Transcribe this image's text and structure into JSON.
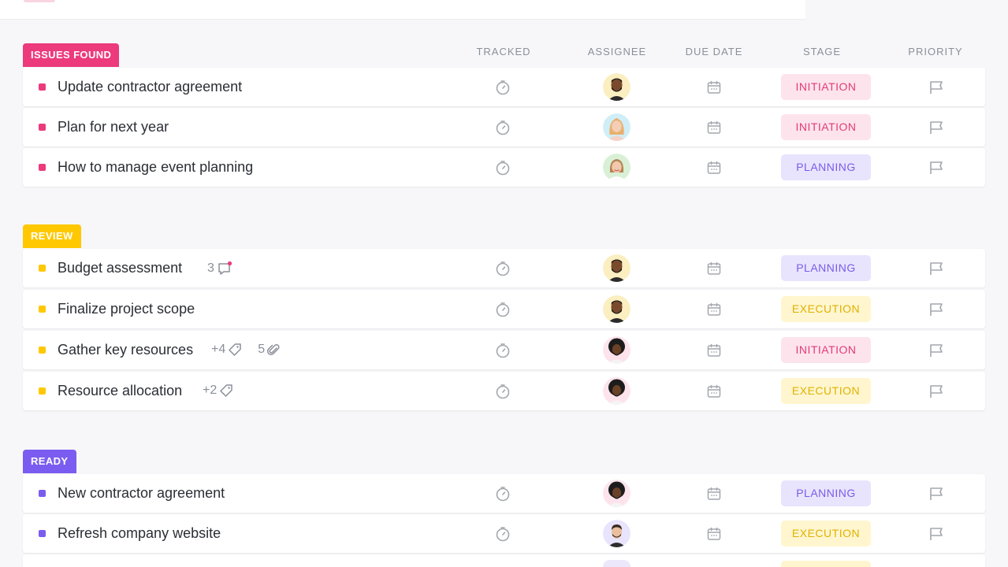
{
  "columns": {
    "tracked": "TRACKED",
    "assignee": "ASSIGNEE",
    "due_date": "DUE DATE",
    "stage": "STAGE",
    "priority": "PRIORITY"
  },
  "colors": {
    "issues_found": "#ec3a7c",
    "review": "#ffc800",
    "ready": "#7b5cf0"
  },
  "groups": [
    {
      "label": "ISSUES FOUND",
      "tasks": [
        {
          "name": "Update contractor agreement",
          "stage": "INITIATION",
          "assignee": "avatar-man-beard"
        },
        {
          "name": "Plan for next year",
          "stage": "INITIATION",
          "assignee": "avatar-woman-blonde"
        },
        {
          "name": "How to manage event planning",
          "stage": "PLANNING",
          "assignee": "avatar-woman-smile"
        }
      ]
    },
    {
      "label": "REVIEW",
      "tasks": [
        {
          "name": "Budget assessment",
          "comments": "3",
          "stage": "PLANNING",
          "assignee": "avatar-man-beard"
        },
        {
          "name": "Finalize project scope",
          "stage": "EXECUTION",
          "assignee": "avatar-man-beard"
        },
        {
          "name": "Gather key resources",
          "tags": "+4",
          "attachments": "5",
          "stage": "INITIATION",
          "assignee": "avatar-man-curly"
        },
        {
          "name": "Resource allocation",
          "tags": "+2",
          "stage": "EXECUTION",
          "assignee": "avatar-man-curly"
        }
      ]
    },
    {
      "label": "READY",
      "tasks": [
        {
          "name": "New contractor agreement",
          "stage": "PLANNING",
          "assignee": "avatar-man-curly"
        },
        {
          "name": "Refresh company website",
          "stage": "EXECUTION",
          "assignee": "avatar-man-short"
        }
      ]
    }
  ]
}
